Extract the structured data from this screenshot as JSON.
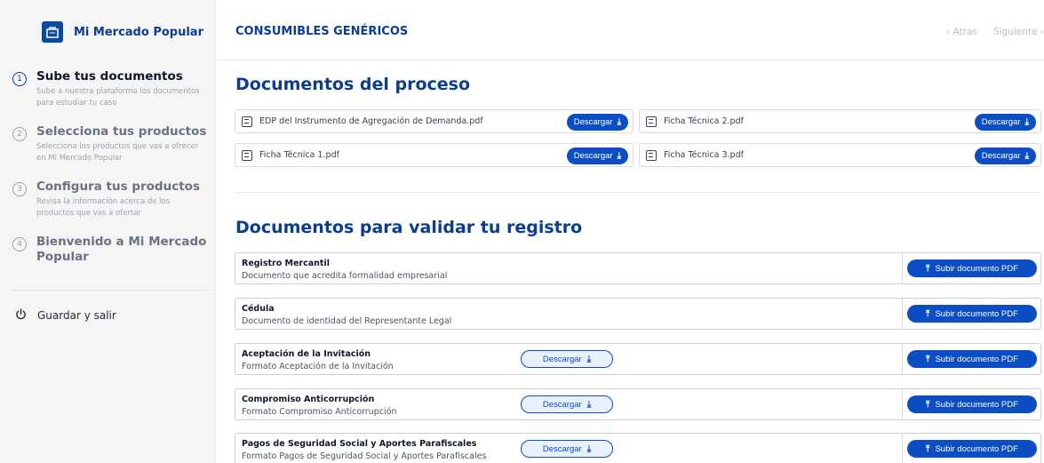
{
  "brand": {
    "name": "Mi Mercado Popular",
    "logo_icon": "basket-logo-icon"
  },
  "steps": [
    {
      "num": "1",
      "title": "Sube tus documentos",
      "desc": "Sube a nuestra plataforma los documentos para estudiar tu caso",
      "active": true
    },
    {
      "num": "2",
      "title": "Selecciona tus productos",
      "desc": "Selecciona los productos que vas a ofrecer en Mi Mercado Popular",
      "active": false
    },
    {
      "num": "3",
      "title": "Configura tus productos",
      "desc": "Revisa la información acerca de los productos que vas a ofertar",
      "active": false
    },
    {
      "num": "4",
      "title": "Bienvenido a Mi Mercado Popular",
      "desc": "",
      "active": false
    }
  ],
  "save_exit": {
    "label": "Guardar y salir",
    "icon": "power-icon"
  },
  "header": {
    "title": "CONSUMIBLES GENÉRICOS",
    "back": "‹ Atras",
    "next": "Siguiente ›"
  },
  "process": {
    "title": "Documentos del proceso",
    "download_label": "Descargar",
    "docs": [
      "EDP del Instrumento de Agregación de Demanda.pdf",
      "Ficha Técnica 2.pdf",
      "Ficha Técnica 1.pdf",
      "Ficha Técnica 3.pdf"
    ]
  },
  "registration": {
    "title": "Documentos para validar tu registro",
    "upload_label": "Subir documento PDF",
    "download_label": "Descargar",
    "rows": [
      {
        "name": "Registro Mercantil",
        "desc": "Documento que acredita formalidad empresarial"
      },
      {
        "name": "Cédula",
        "desc": "Documento de identidad del Representante Legal"
      },
      {
        "name": "Aceptación de la Invitación",
        "desc": "Formato Aceptación de la Invitación"
      },
      {
        "name": "Compromiso Anticorrupción",
        "desc": "Formato Compromiso Anticorrupción"
      },
      {
        "name": "Pagos de Seguridad Social y Aportes Parafiscales",
        "desc": "Formato Pagos de Seguridad Social y Aportes Parafiscales"
      }
    ]
  },
  "colors": {
    "primary": "#0b3d91",
    "button": "#0b4ec4",
    "sidebar_bg": "#f5f5f5"
  }
}
